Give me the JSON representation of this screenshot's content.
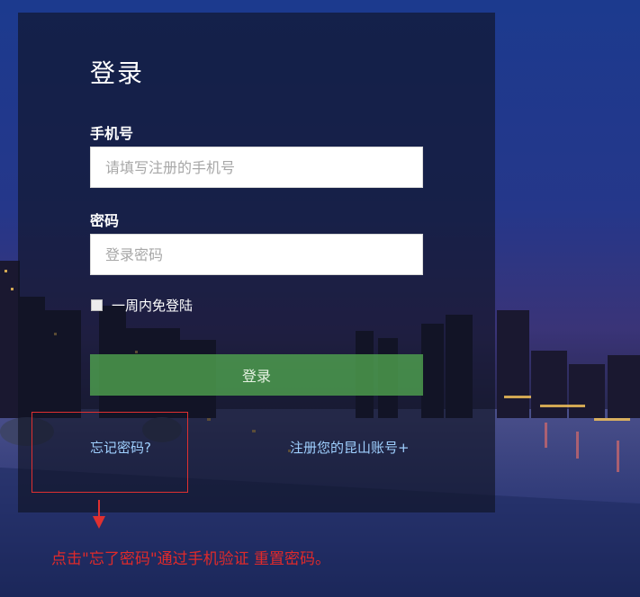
{
  "login": {
    "title": "登录",
    "phone_label": "手机号",
    "phone_placeholder": "请填写注册的手机号",
    "password_label": "密码",
    "password_placeholder": "登录密码",
    "remember_label": "一周内免登陆",
    "submit_label": "登录",
    "forgot_link": "忘记密码?",
    "register_link": "注册您的昆山账号+"
  },
  "annotation": {
    "text": "点击\"忘了密码\"通过手机验证 重置密码。",
    "color": "#e02a2a"
  },
  "colors": {
    "button_green": "#4ea04e",
    "link_blue": "#9fd0ff",
    "panel": "#0e1220"
  }
}
